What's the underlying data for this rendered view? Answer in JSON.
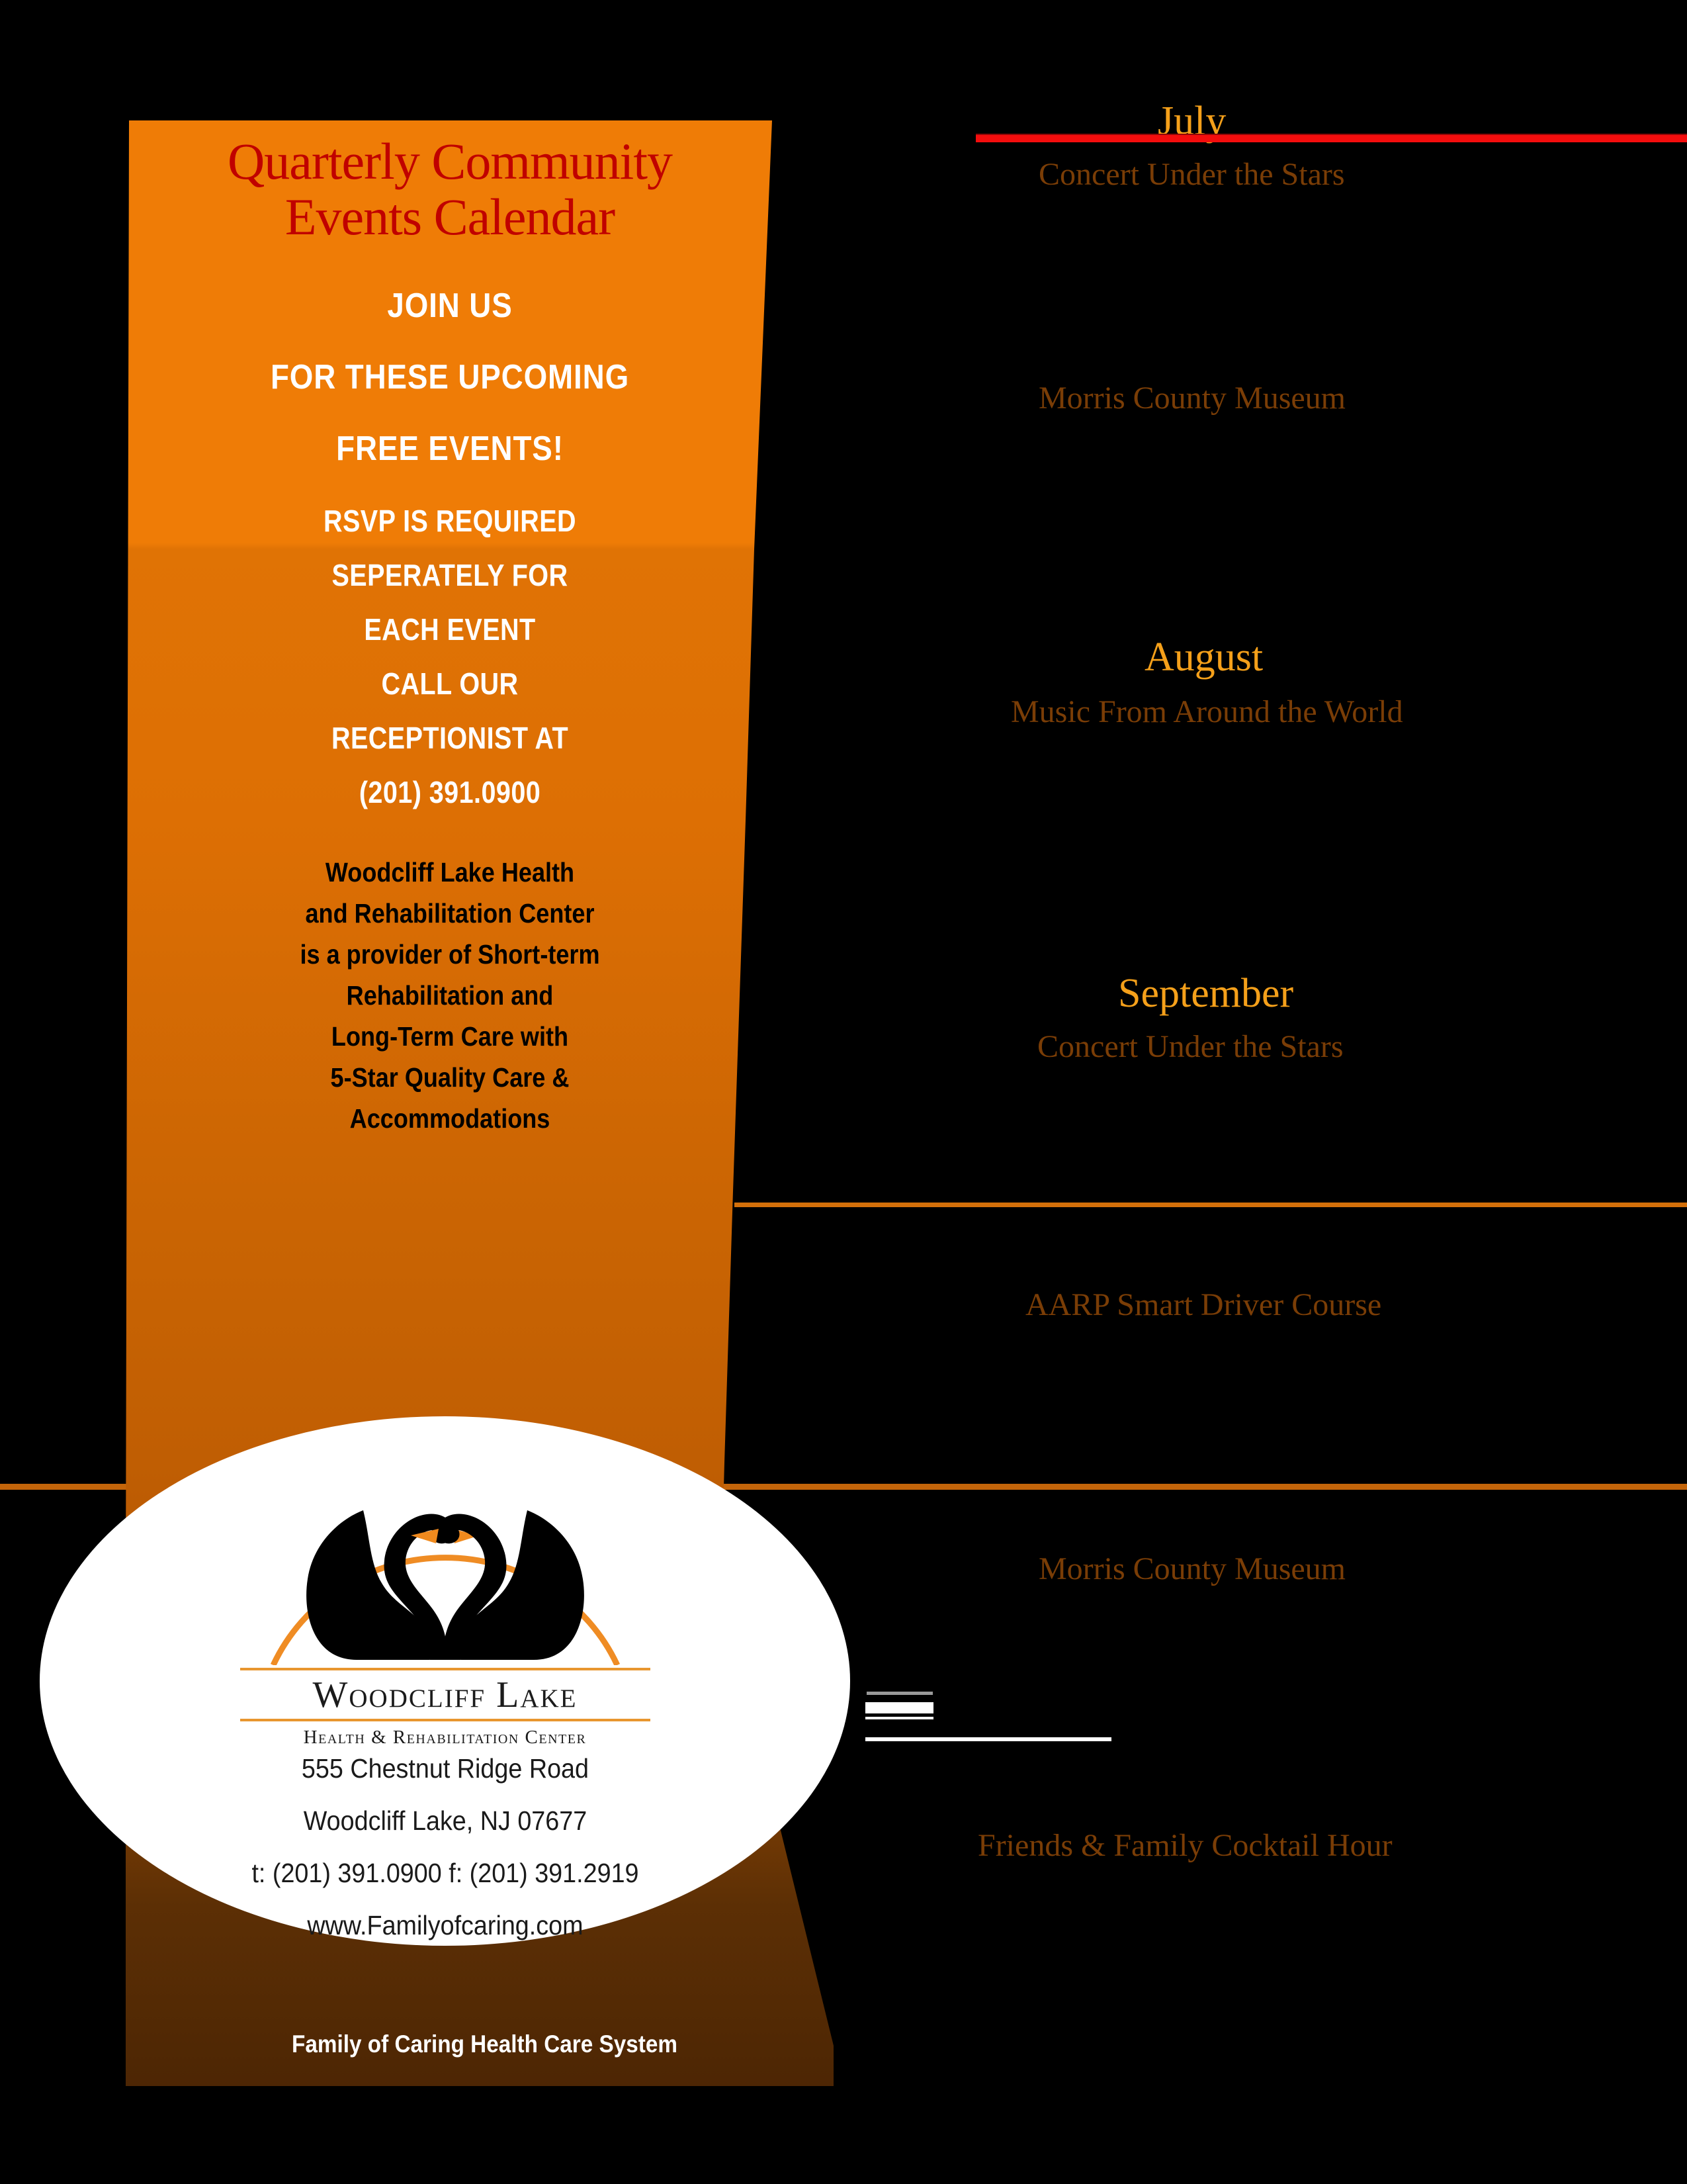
{
  "banner": {
    "title_line1": "Quarterly Community",
    "title_line2": "Events Calendar",
    "join": [
      "JOIN US",
      "FOR THESE UPCOMING",
      "FREE EVENTS!"
    ],
    "rsvp": [
      "RSVP IS REQUIRED",
      "SEPERATELY FOR",
      "EACH EVENT",
      "CALL OUR",
      "RECEPTIONIST AT",
      "(201) 391.0900"
    ],
    "description": [
      "Woodcliff Lake Health",
      "and Rehabilitation Center",
      "is a provider of Short-term",
      "Rehabilitation and",
      "Long-Term Care with",
      "5-Star Quality Care &",
      "Accommodations"
    ],
    "footer": "Family of Caring Health Care System"
  },
  "calendar": {
    "months": [
      {
        "name": "July",
        "event": "Concert Under the Stars"
      },
      {
        "name": "August",
        "event": "Music From Around the World"
      },
      {
        "name": "September",
        "event": "Concert Under the Stars"
      }
    ],
    "extra_events": [
      "Morris County Museum",
      "AARP Smart Driver Course",
      "Morris County Museum",
      "Friends & Family Cocktail Hour"
    ]
  },
  "logo": {
    "name_main": "Woodcliff Lake",
    "name_sub": "Health & Rehabilitation Center",
    "address": [
      "555 Chestnut Ridge Road",
      "Woodcliff Lake, NJ 07677",
      "t: (201) 391.0900  f: (201) 391.2919",
      "www.Familyofcaring.com"
    ]
  },
  "colors": {
    "banner_orange": "#ef7c06",
    "title_red": "#c00000",
    "month_gold": "#f5a01a",
    "event_brown": "#7a3d06",
    "rule_red": "#f40d0d",
    "rule_orange": "#c4650a",
    "logo_arc_orange": "#ef8c24",
    "background": "#000000"
  }
}
